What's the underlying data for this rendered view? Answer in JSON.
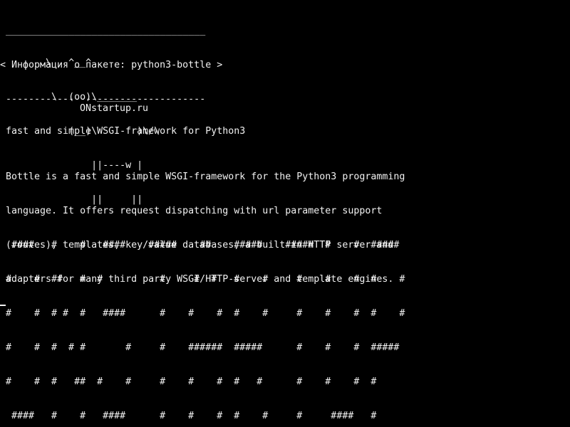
{
  "terminal": {
    "cowsay_bubble": [
      " ___________________________________",
      "< Информация о пакете: python3-bottle >",
      " -----------------------------------"
    ],
    "cow": [
      "        \\   ^__^",
      "         \\  (oo)\\_______",
      "            (__)\\       )\\/\\",
      "                ||----w |",
      "                ||     ||"
    ],
    "site": "ONstartup.ru",
    "summary": "fast and simple WSGI-framework for Python3",
    "description": [
      "Bottle is a fast and simple WSGI-framework for the Python3 programming",
      "language. It offers request dispatching with url parameter support",
      "(routes), templates, key/value databases, a built-in HTTP server and",
      "adapters for many third party WSGI/HTTP-server and template engines."
    ],
    "banner": [
      " ####   #    #   ####    #####    ##    #####    #####  #    #  #####",
      "#    #  ##   #  #          #     #  #   #    #     #    #    #  #    #",
      "#    #  # #  #   ####      #    #    #  #    #     #    #    #  #    #",
      "#    #  #  # #       #     #    ######  #####      #    #    #  #####",
      "#    #  #   ##  #    #     #    #    #  #   #      #    #    #  #",
      " ####   #    #   ####      #    #    #  #    #     #     ####   #"
    ]
  }
}
